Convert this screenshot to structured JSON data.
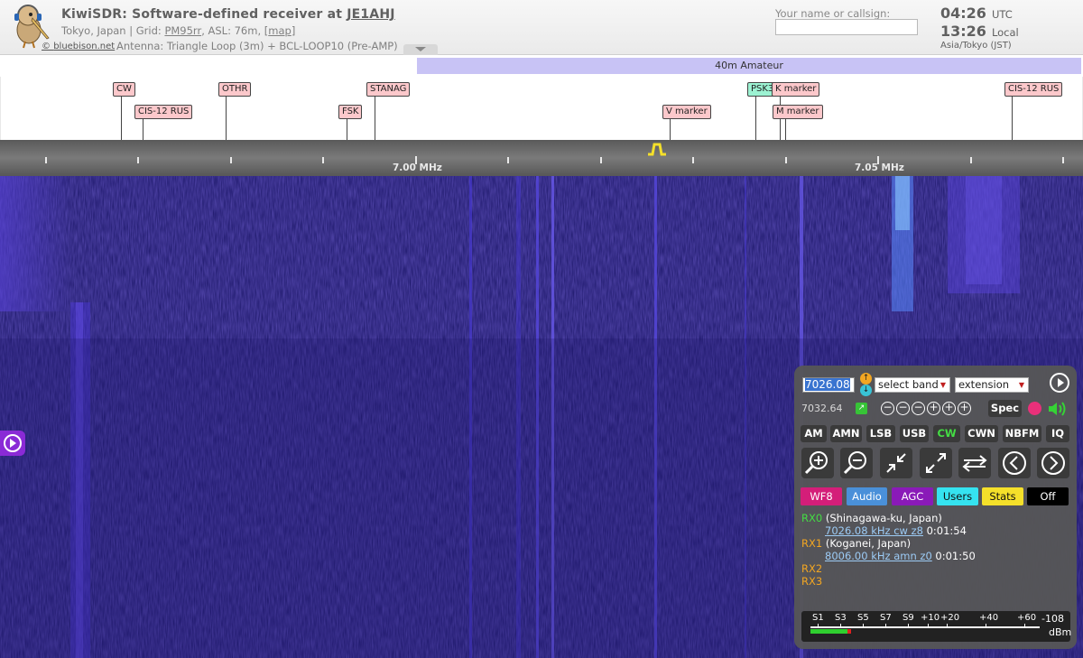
{
  "header": {
    "title_prefix": "KiwiSDR: Software-defined receiver at ",
    "callsign": "JE1AHJ",
    "location_prefix": "Tokyo, Japan | Grid: ",
    "grid": "PM95rr",
    "location_mid": ", ASL: 76m, [",
    "map_link": "map",
    "location_suffix": "]",
    "antenna": "Antenna: Triangle Loop (3m) + BCL-LOOP10 (Pre-AMP)",
    "logo_credit": "bluebison.net",
    "logo_credit_prefix": "© ",
    "name_label": "Your name or callsign:",
    "name_value": "",
    "clock_utc": "04:26",
    "clock_utc_unit": "UTC",
    "clock_local": "13:26",
    "clock_local_unit": "Local",
    "timezone": "Asia/Tokyo (JST)"
  },
  "band_bar": {
    "amateur_label": "40m Amateur"
  },
  "dx_labels": [
    "CW",
    "CIS-12 RUS",
    "OTHR",
    "FSK",
    "STANAG",
    "V marker",
    "PSK3",
    "K marker",
    "M marker",
    "CIS-12 RUS"
  ],
  "scale": {
    "label_700": "7.00 MHz",
    "label_705": "7.05 MHz"
  },
  "panel": {
    "frequency": "7026.08",
    "step_up_symbol": "↑",
    "step_down_symbol": "↓",
    "band_select": "select band",
    "extension_select": "extension",
    "freq_alt": "7032.64",
    "spec_label": "Spec",
    "modes": [
      "AM",
      "AMN",
      "LSB",
      "USB",
      "CW",
      "CWN",
      "NBFM",
      "IQ"
    ],
    "active_mode": "CW",
    "options": [
      "WF8",
      "Audio",
      "AGC",
      "Users",
      "Stats",
      "Off"
    ],
    "colors": {
      "wf8": "#d41e79",
      "audio": "#4a90d9",
      "agc": "#8a1ab8",
      "users": "#35e3f0",
      "stats": "#f5e02a",
      "off": "#000000"
    },
    "users": [
      {
        "rx": "RX0",
        "rx_color": "#44dd44",
        "name": "(Shinagawa-ku, Japan)",
        "link": "7026.08 kHz cw z8",
        "time": "0:01:54"
      },
      {
        "rx": "RX1",
        "rx_color": "#f2a622",
        "name": "(Koganei, Japan)",
        "link": "8006.00 kHz amn z0",
        "time": "0:01:50"
      },
      {
        "rx": "RX2",
        "rx_color": "#f2a622",
        "name": "",
        "link": "",
        "time": ""
      },
      {
        "rx": "RX3",
        "rx_color": "#f2a622",
        "name": "",
        "link": "",
        "time": ""
      }
    ],
    "smeter": {
      "labels": [
        "S1",
        "S3",
        "S5",
        "S7",
        "S9",
        "+10",
        "+20",
        "+40",
        "+60"
      ],
      "dbm_value": "-108",
      "dbm_unit": "dBm",
      "level_fraction": 0.16
    }
  }
}
